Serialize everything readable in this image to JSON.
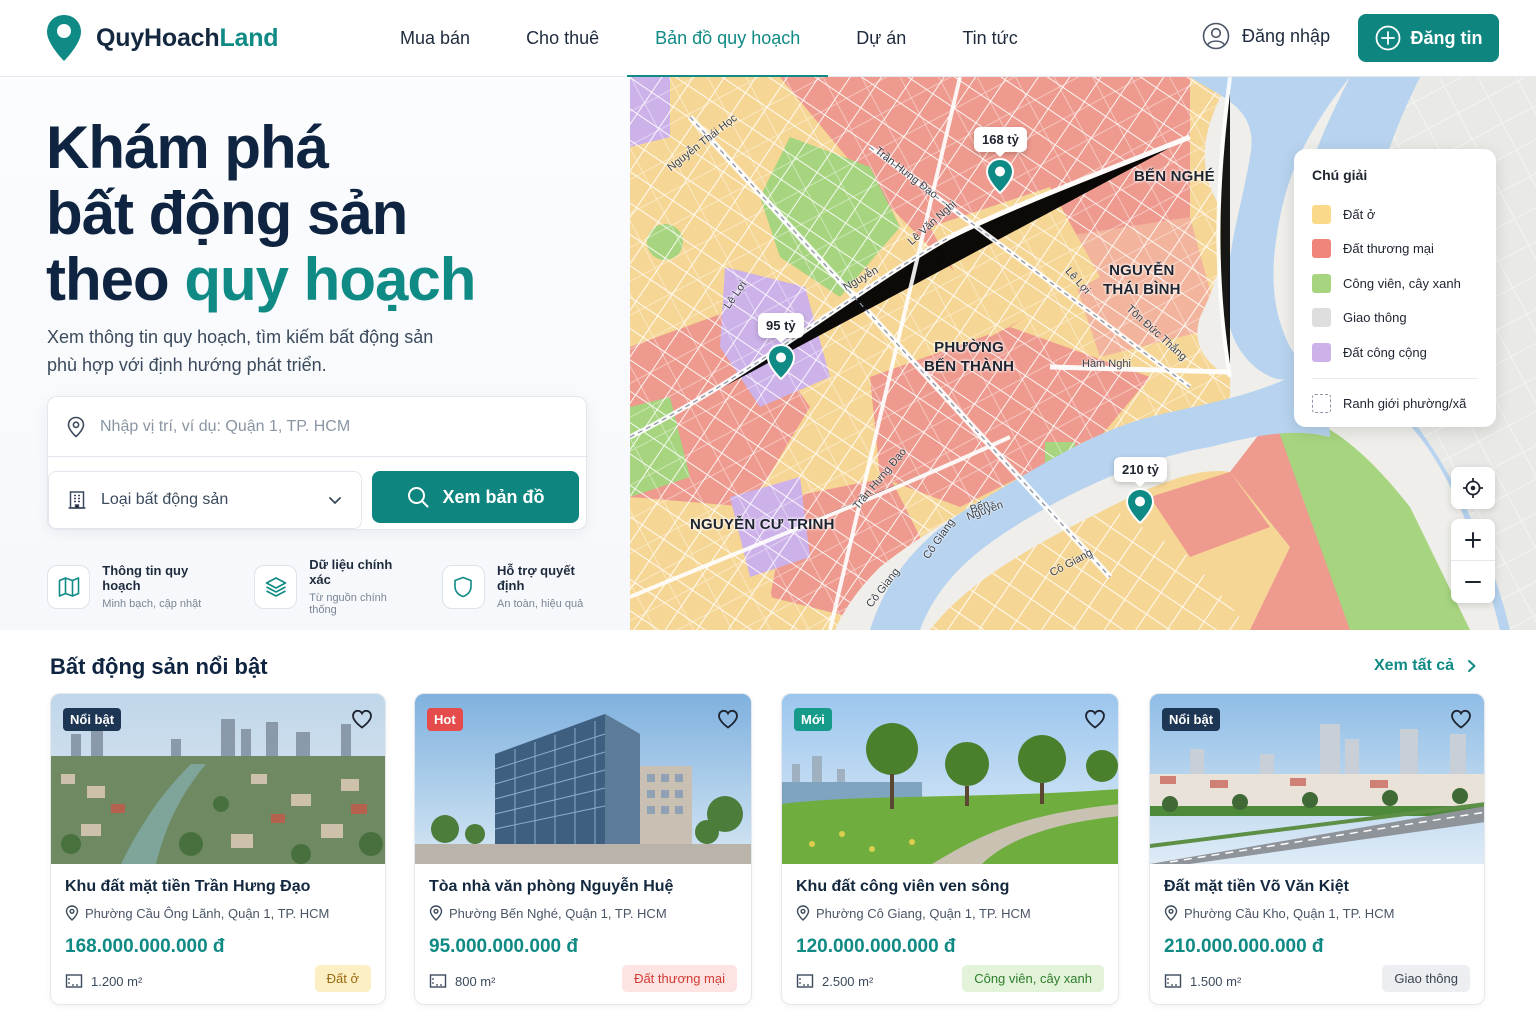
{
  "header": {
    "logo_prefix": "QuyHoach",
    "logo_suffix": "Land",
    "nav": [
      "Mua bán",
      "Cho thuê",
      "Bản đồ quy hoạch",
      "Dự án",
      "Tin tức"
    ],
    "active_nav": "Bản đồ quy hoạch",
    "login_label": "Đăng nhập",
    "post_label": "Đăng tin",
    "brand_color": "#0f8580"
  },
  "hero": {
    "title_line1": "Khám phá",
    "title_line2": "bất động sản",
    "title_line3_prefix": "theo ",
    "title_line3_accent": "quy hoạch",
    "subtitle": "Xem thông tin quy hoạch, tìm kiếm bất động sản phù hợp với định hướng phát triển.",
    "search_placeholder": "Nhập vị trí, ví dụ: Quận 1, TP. HCM",
    "type_select_label": "Loại bất động sản",
    "map_button_label": "Xem bản đồ",
    "features": [
      {
        "icon": "map-icon",
        "title": "Thông tin quy hoạch",
        "desc": "Minh bạch, cập nhật"
      },
      {
        "icon": "layers-icon",
        "title": "Dữ liệu chính xác",
        "desc": "Từ nguồn chính thống"
      },
      {
        "icon": "shield-icon",
        "title": "Hỗ trợ quyết định",
        "desc": "An toàn, hiệu quả"
      }
    ]
  },
  "map": {
    "area_labels": [
      {
        "text": "BẾN NGHÉ"
      },
      {
        "text": "NGUYỄN\nTHÁI BÌNH"
      },
      {
        "text": "PHƯỜNG\nBẾN THÀNH"
      },
      {
        "text": "NGUYỄN CƯ TRINH"
      }
    ],
    "street_labels": [
      "Nguyễn Thái Học",
      "Trần Hưng Đạo",
      "Lê Văn Nghị",
      "Lê Lợi",
      "Nguyễn",
      "Lê Lợi",
      "Hàm Nghi",
      "Tôn Đức Thắng",
      "Cô Giang",
      "Cô Giang",
      "Trần Hưng Đạo",
      "Nguyễn",
      "Bến",
      "Cô Giang"
    ],
    "price_pins": [
      "168 tỷ",
      "95 tỷ",
      "210 tỷ"
    ],
    "legend": {
      "title": "Chú giải",
      "items": [
        {
          "label": "Đất ở",
          "color": "#fbd98a"
        },
        {
          "label": "Đất thương mại",
          "color": "#f0857c"
        },
        {
          "label": "Công viên, cây xanh",
          "color": "#a6d47f"
        },
        {
          "label": "Giao thông",
          "color": "#dedede"
        },
        {
          "label": "Đất công cộng",
          "color": "#cdb2ea"
        }
      ],
      "boundary_label": "Ranh giới phường/xã"
    }
  },
  "listings": {
    "section_title": "Bất động sản nổi bật",
    "see_all_label": "Xem tất cả",
    "cards": [
      {
        "badge": "Nổi bật",
        "badge_color": "#1c3654",
        "title": "Khu đất mặt tiền Trần Hưng Đạo",
        "location": "Phường Cầu Ông Lãnh, Quận 1, TP. HCM",
        "price": "168.000.000.000 đ",
        "area": "1.200 m²",
        "zone": "Đất ở",
        "zone_bg": "#fdefc4",
        "zone_fg": "#9a6a10"
      },
      {
        "badge": "Hot",
        "badge_color": "#e64b4b",
        "title": "Tòa nhà văn phòng Nguyễn Huệ",
        "location": "Phường Bến Nghé, Quận 1, TP. HCM",
        "price": "95.000.000.000 đ",
        "area": "800 m²",
        "zone": "Đất thương mại",
        "zone_bg": "#fde3e1",
        "zone_fg": "#d23b34"
      },
      {
        "badge": "Mới",
        "badge_color": "#169a8a",
        "title": "Khu đất công viên ven sông",
        "location": "Phường Cô Giang, Quận 1, TP. HCM",
        "price": "120.000.000.000 đ",
        "area": "2.500 m²",
        "zone": "Công viên, cây xanh",
        "zone_bg": "#e2f3da",
        "zone_fg": "#2f7d2a"
      },
      {
        "badge": "Nổi bật",
        "badge_color": "#1c3654",
        "title": "Đất mặt tiền Võ Văn Kiệt",
        "location": "Phường Cầu Kho, Quận 1, TP. HCM",
        "price": "210.000.000.000 đ",
        "area": "1.500 m²",
        "zone": "Giao thông",
        "zone_bg": "#eceef1",
        "zone_fg": "#3b4350"
      }
    ]
  }
}
